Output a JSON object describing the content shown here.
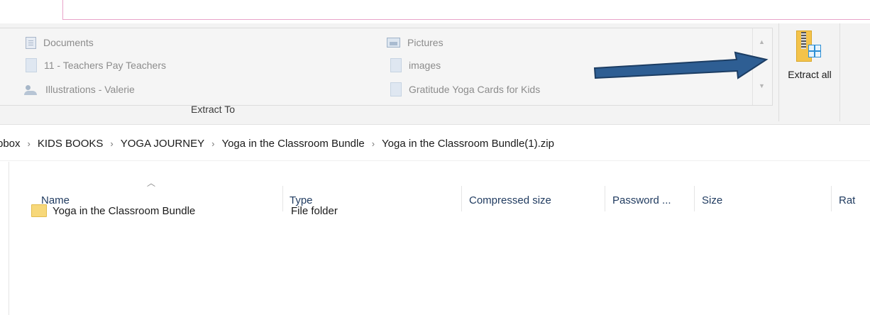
{
  "ribbon": {
    "gallery_items": [
      {
        "label": "Documents",
        "icon": "documents-icon"
      },
      {
        "label": "11 - Teachers Pay Teachers",
        "icon": "folder-icon"
      },
      {
        "label": "Illustrations - Valerie",
        "icon": "people-folder-icon"
      },
      {
        "label": "Pictures",
        "icon": "pictures-icon"
      },
      {
        "label": "images",
        "icon": "folder-icon"
      },
      {
        "label": "Gratitude Yoga Cards for Kids",
        "icon": "folder-icon"
      }
    ],
    "group_label": "Extract To",
    "extract_all_label": "Extract all"
  },
  "breadcrumb": {
    "items": [
      "pbox",
      "KIDS BOOKS",
      "YOGA JOURNEY",
      "Yoga in the Classroom Bundle",
      "Yoga in the Classroom Bundle(1).zip"
    ],
    "separator": "›"
  },
  "columns": [
    "Name",
    "Type",
    "Compressed size",
    "Password ...",
    "Size",
    "Rat"
  ],
  "files": [
    {
      "name": "Yoga in the Classroom Bundle",
      "type": "File folder"
    }
  ],
  "annotation": {
    "arrow_color": "#2e5e93"
  }
}
